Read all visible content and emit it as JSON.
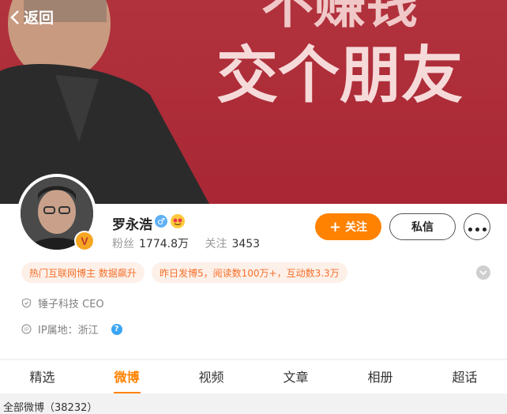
{
  "header": {
    "back_label": "返回"
  },
  "banner": {
    "slogan_line1": "不赚钱",
    "slogan_line2": "交个朋友"
  },
  "profile": {
    "name": "罗永浩",
    "verified_badge": "V",
    "gender_symbol": "♂",
    "fans_label": "粉丝",
    "fans_value": "1774.8万",
    "following_label": "关注",
    "following_value": "3453",
    "follow_button": "关注",
    "message_button": "私信"
  },
  "tags": [
    {
      "label": "热门互联网博主 数据飙升"
    },
    {
      "label": "昨日发博5，阅读数100万+，互动数3.3万"
    }
  ],
  "info": {
    "company": "锤子科技 CEO",
    "ip_location": "IP属地：浙江",
    "help_symbol": "?"
  },
  "tabs": [
    {
      "label": "精选"
    },
    {
      "label": "微博",
      "active": true
    },
    {
      "label": "视频"
    },
    {
      "label": "文章"
    },
    {
      "label": "相册"
    },
    {
      "label": "超话"
    }
  ],
  "feed": {
    "count_text": "全部微博（38232）"
  },
  "colors": {
    "accent": "#ff8200",
    "banner": "#ad2b37",
    "tag_text": "#f5702c"
  },
  "icons": [
    "chevron-left-icon",
    "male-icon",
    "emoji-icon",
    "more-dots-icon",
    "shield-icon",
    "ip-icon",
    "help-icon",
    "chevron-down-icon",
    "verified-icon"
  ]
}
